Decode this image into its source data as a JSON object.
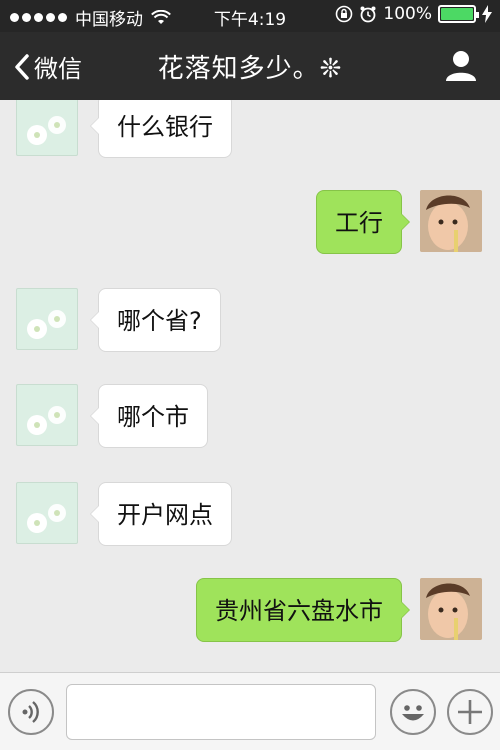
{
  "status_bar": {
    "carrier": "中国移动",
    "time": "下午4:19",
    "battery": "100%",
    "battery_level": 1.0
  },
  "nav": {
    "back_label": "微信",
    "title": "花落知多少。❊"
  },
  "messages": [
    {
      "side": "in",
      "text": "什么银行"
    },
    {
      "side": "out",
      "text": "工行"
    },
    {
      "side": "in",
      "text": "哪个省?"
    },
    {
      "side": "in",
      "text": "哪个市"
    },
    {
      "side": "in",
      "text": "开户网点"
    },
    {
      "side": "out",
      "text": "贵州省六盘水市"
    }
  ],
  "input": {
    "value": "",
    "placeholder": ""
  },
  "colors": {
    "outgoing_bubble": "#9fe35b",
    "incoming_bubble": "#ffffff",
    "nav_bg": "#2c2c2c",
    "battery": "#4cd964"
  }
}
